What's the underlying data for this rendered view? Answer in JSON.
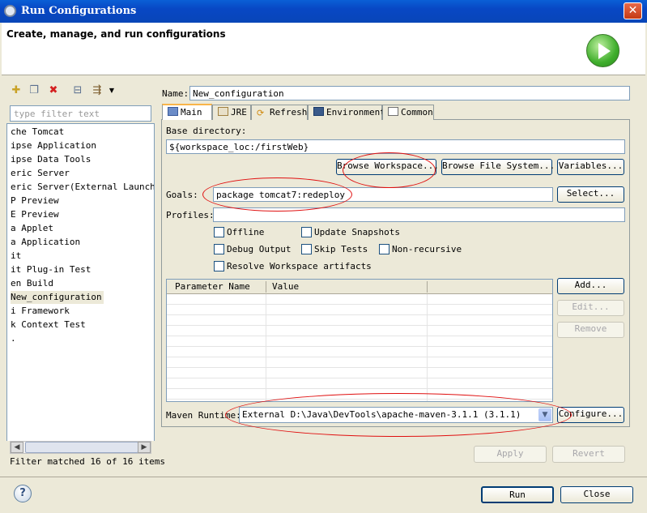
{
  "window": {
    "title": "Run Configurations",
    "close_glyph": "✕"
  },
  "header": {
    "title": "Create, manage, and run configurations"
  },
  "left": {
    "filter_placeholder": "type filter text",
    "items": [
      "che Tomcat",
      "ipse Application",
      "ipse Data Tools",
      "eric Server",
      "eric Server(External Launch)",
      "P Preview",
      "E Preview",
      "a Applet",
      "a Application",
      "it",
      "it Plug-in Test",
      "en Build",
      "New_configuration",
      "i Framework",
      "k Context Test",
      "."
    ],
    "selected_index": 12,
    "status": "Filter matched 16 of 16 items"
  },
  "right": {
    "name_label": "Name:",
    "name_value": "New_configuration",
    "tabs": [
      "Main",
      "JRE",
      "Refresh",
      "Environment",
      "Common"
    ],
    "base_dir_label": "Base directory:",
    "base_dir_value": "${workspace_loc:/firstWeb}",
    "browse_workspace": "Browse Workspace...",
    "browse_fs": "Browse File System...",
    "variables": "Variables...",
    "goals_label": "Goals:",
    "goals_value": "package tomcat7:redeploy",
    "select": "Select...",
    "profiles_label": "Profiles:",
    "profiles_value": "",
    "checks": {
      "offline": "Offline",
      "update_snapshots": "Update Snapshots",
      "debug_output": "Debug Output",
      "skip_tests": "Skip Tests",
      "non_recursive": "Non-recursive",
      "resolve_workspace": "Resolve Workspace artifacts"
    },
    "params": {
      "col1": "Parameter Name",
      "col2": "Value"
    },
    "add": "Add...",
    "edit": "Edit...",
    "remove": "Remove",
    "runtime_label": "Maven Runtime:",
    "runtime_value": "External D:\\Java\\DevTools\\apache-maven-3.1.1 (3.1.1)",
    "configure": "Configure...",
    "apply": "Apply",
    "revert": "Revert"
  },
  "footer": {
    "run": "Run",
    "close": "Close",
    "help_glyph": "?"
  },
  "colors": {
    "title_bar": "#0846b8",
    "annotation": "#e01010",
    "tab_highlight": "#f9b54a"
  }
}
